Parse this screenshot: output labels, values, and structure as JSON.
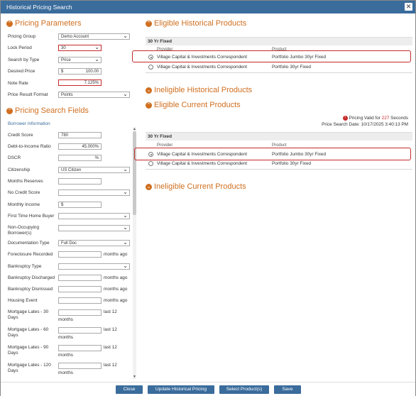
{
  "dialog": {
    "title": "Historical Pricing Search"
  },
  "pricing_parameters": {
    "heading": "Pricing Parameters",
    "fields": [
      {
        "label": "Pricing Group",
        "value": "Demo Account"
      },
      {
        "label": "Lock Period",
        "value": "30"
      },
      {
        "label": "Search by Type",
        "value": "Price"
      },
      {
        "label": "Desired Price",
        "prefix": "$",
        "value": "100.00"
      },
      {
        "label": "Note Rate",
        "value": "7.125%"
      },
      {
        "label": "Price Result Format",
        "value": "Points"
      }
    ]
  },
  "search_fields": {
    "heading": "Pricing Search Fields",
    "subheading": "Borrower Information",
    "fields": [
      {
        "label": "Credit Score",
        "value": "780"
      },
      {
        "label": "Debt-to-Income Ratio",
        "value": "45.000%"
      },
      {
        "label": "DSCR",
        "value": "%"
      },
      {
        "label": "Citizenship",
        "value": "US Citizen"
      },
      {
        "label": "Months Reserves",
        "value": ""
      },
      {
        "label": "No Credit Score",
        "value": ""
      },
      {
        "label": "Monthly Income",
        "prefix": "$",
        "value": ""
      },
      {
        "label": "First Time Home Buyer",
        "value": ""
      },
      {
        "label": "Non-Occupying",
        "label2": "Borrower(s)",
        "value": ""
      },
      {
        "label": "Documentation Type",
        "value": "Full Doc"
      },
      {
        "label": "Foreclosure Recorded",
        "suffix": "months ago"
      },
      {
        "label": "Bankruptcy Type",
        "value": ""
      },
      {
        "label": "Bankruptcy Discharged",
        "suffix": "months ago"
      },
      {
        "label": "Bankruptcy Dismissed",
        "suffix": "months ago"
      },
      {
        "label": "Housing Event",
        "suffix": "months ago"
      },
      {
        "label": "Mortgage Lates - 30",
        "label2": "Days",
        "suffix": "last 12",
        "suffix2": "months"
      },
      {
        "label": "Mortgage Lates - 60",
        "label2": "Days",
        "suffix": "last 12",
        "suffix2": "months"
      },
      {
        "label": "Mortgage Lates - 90",
        "label2": "Days",
        "suffix": "last 12",
        "suffix2": "months"
      },
      {
        "label": "Mortgage Lates - 120",
        "label2": "Days",
        "suffix": "last 12",
        "suffix2": "months"
      }
    ]
  },
  "eligible_historical": {
    "heading": "Eligible Historical Products",
    "group": "30 Yr Fixed",
    "col_provider": "Provider",
    "col_product": "Product",
    "rows": [
      {
        "provider": "Village Capital & Investments Correspondent",
        "product": "Portfolio Jumbo 30yr Fixed",
        "selected": true
      },
      {
        "provider": "Village Capital & Investments Correspondent",
        "product": "Portfolio 30yr Fixed",
        "selected": false
      }
    ]
  },
  "ineligible_historical": {
    "heading": "Ineligible Historical Products"
  },
  "eligible_current": {
    "heading": "Eligible Current Products",
    "valid_prefix": "Pricing Valid for",
    "valid_seconds": "227",
    "valid_suffix": "Seconds",
    "search_date": "Price Search Date: 10/17/2025 3:40:13 PM",
    "group": "30 Yr Fixed",
    "col_provider": "Provider",
    "col_product": "Product",
    "rows": [
      {
        "provider": "Village Capital & Investments Correspondent",
        "product": "Portfolio Jumbo 30yr Fixed",
        "selected": true
      },
      {
        "provider": "Village Capital & Investments Correspondent",
        "product": "Portfolio 30yr Fixed",
        "selected": false
      }
    ]
  },
  "ineligible_current": {
    "heading": "Ineligible Current Products"
  },
  "footer": {
    "close": "Close",
    "update": "Update Historical Pricing",
    "select": "Select Product(s)",
    "save": "Save"
  },
  "colors": {
    "accent": "#d06f20",
    "titlebar": "#3a6c9c",
    "highlight": "#c52a2a"
  }
}
